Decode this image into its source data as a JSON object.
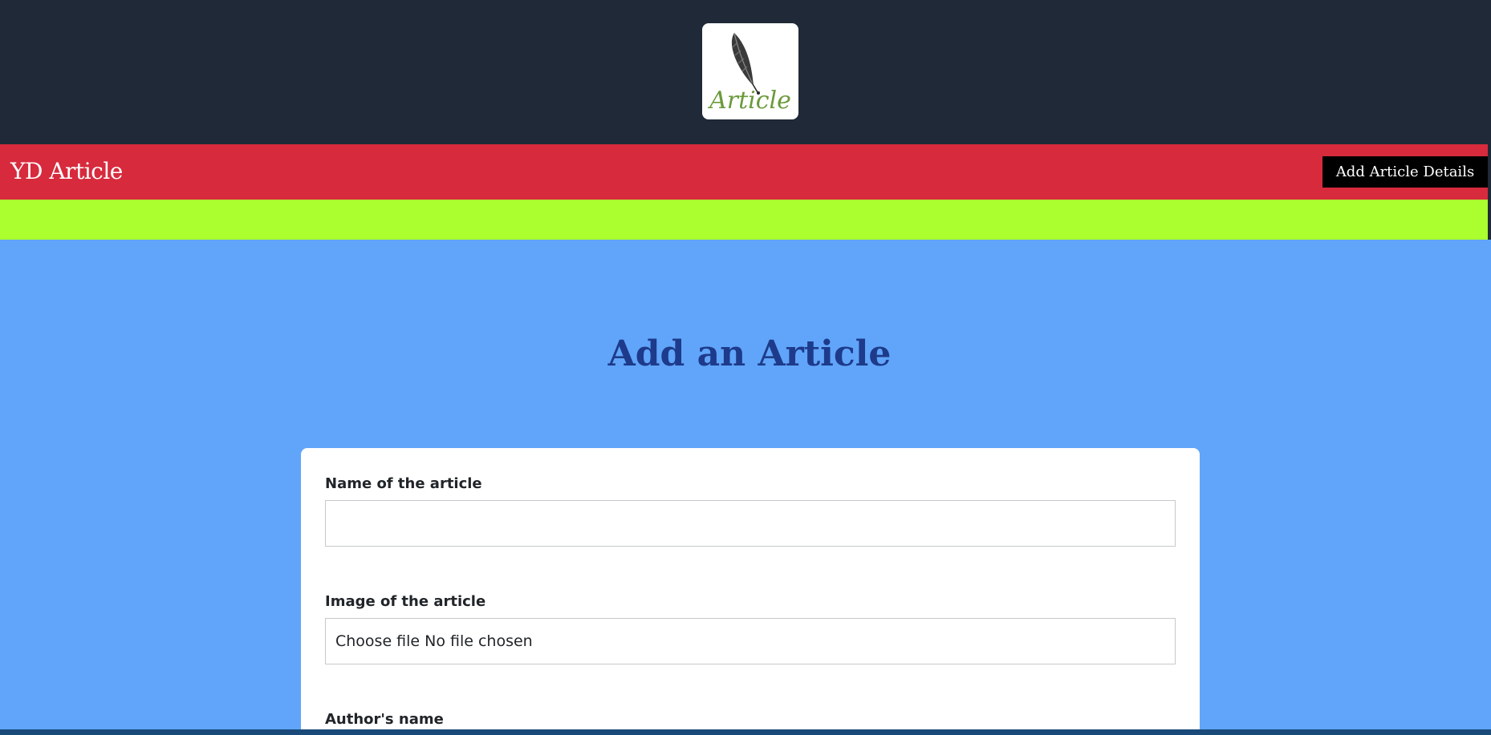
{
  "header": {
    "logo_text": "Article",
    "logo_icon": "quill-feather-icon"
  },
  "navbar": {
    "brand": "YD Article",
    "add_details_button": "Add Article Details"
  },
  "page": {
    "title": "Add an Article"
  },
  "form": {
    "name_label": "Name of the article",
    "name_value": "",
    "image_label": "Image of the article",
    "file_button": "Choose file",
    "file_status": "No file chosen",
    "author_label": "Author's name"
  },
  "colors": {
    "header_bg": "#1f2937",
    "navbar_bg": "#d72a3d",
    "accent_strip": "#abff2e",
    "page_bg": "#60a5fa",
    "title_color": "#1e3a8a",
    "logo_text_green": "#6a9a3a"
  }
}
